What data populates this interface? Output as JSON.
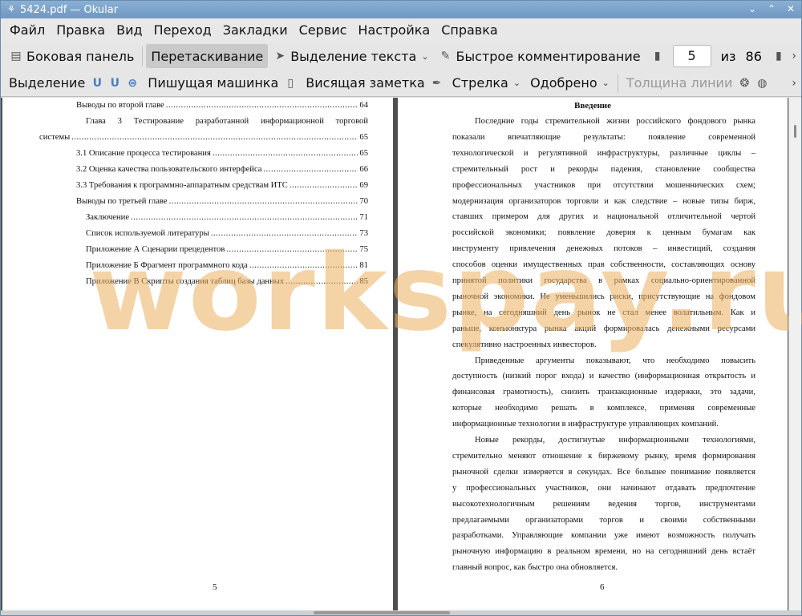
{
  "window": {
    "title": "5424.pdf  — Okular",
    "minimize_glyph": "⌄",
    "maximize_glyph": "⌃",
    "close_glyph": "✕"
  },
  "menu": [
    "Файл",
    "Правка",
    "Вид",
    "Переход",
    "Закладки",
    "Сервис",
    "Настройка",
    "Справка"
  ],
  "toolbar1": {
    "sidebar": "Боковая панель",
    "browse": "Перетаскивание",
    "text_select": "Выделение текста",
    "quick_annotations": "Быстрое комментирование",
    "page_current": "5",
    "page_of": "из",
    "page_total": "86"
  },
  "toolbar2": {
    "highlight": "Выделение",
    "typewriter": "Пишущая машинка",
    "note": "Висящая заметка",
    "arrow": "Стрелка",
    "stamp": "Одобрено",
    "line_width": "Толщина линии"
  },
  "page_left": {
    "toc": [
      {
        "text": "Выводы по второй главе",
        "page": "64"
      },
      {
        "text_line1": "Глава 3 Тестирование разработанной информационной торговой",
        "text_line2": "системы",
        "page": "65"
      },
      {
        "text": "3.1 Описание процесса тестирования",
        "page": "65"
      },
      {
        "text": "3.2 Оценка качества пользовательского интерфейса",
        "page": "66"
      },
      {
        "text": "3.3 Требования к программно-аппаратным средствам ИТС",
        "page": "69"
      },
      {
        "text": "Выводы по третьей главе",
        "page": "70"
      },
      {
        "text": "Заключение",
        "page": "71"
      },
      {
        "text": "Список используемой литературы",
        "page": "73"
      },
      {
        "text": "Приложение А Сценарии прецедентов",
        "page": "75"
      },
      {
        "text": "Приложение Б Фрагмент программного кода",
        "page": "81"
      },
      {
        "text": "Приложение В Скрипты создания таблиц базы данных",
        "page": "85"
      }
    ],
    "page_number": "5"
  },
  "page_right": {
    "heading": "Введение",
    "lines": [
      "Последние годы стремительной жизни российского фондового рынка",
      "показали впечатляющие результаты: появление современной",
      "технологической и регулятивной инфраструктуры, различные циклы –",
      "стремительный рост и рекорды падения, становление сообщества",
      "профессиональных участников при отсутствии мошеннических схем;",
      "модернизация организаторов торговли и как следствие – новые типы бирж,",
      "ставших примером для других и национальной отличительной чертой",
      "российской экономики; появление доверия к ценным бумагам как",
      "инструменту привлечения денежных потоков – инвестиций, создания",
      "способов оценки имущественных прав собственности, составляющих основу",
      "принятой политики государства в рамках социально-ориентированной",
      "рыночной экономики. Не уменьшились риски, присутствующие на фондовом",
      "рынке, на сегодняшний день рынок не стал менее волатильным. Как и",
      "раньше, конъюнктура рынка акций формировалась денежными ресурсами",
      "спекулятивно настроенных инвесторов.",
      "Приведенные аргументы показывают, что необходимо повысить",
      "доступность (низкий порог входа) и качество (информационная открытость и",
      "финансовая грамотность), снизить транзакционные издержки, это задачи,",
      "которые необходимо решать в комплексе, применяя современные",
      "информационные технологии в инфраструктуре управляющих компаний.",
      "Новые рекорды, достигнутые информационными технологиями,",
      "стремительно меняют отношение к биржевому рынку, время формирования",
      "рыночной сделки измеряется в секундах. Все большее понимание появляется",
      "у профессиональных участников, они начинают отдавать предпочтение",
      "высокотехнологичным решениям ведения торгов, инструментами",
      "предлагаемыми организаторами торгов и своими собственными",
      "разработками. Управляющие компании уже имеют возможность получать",
      "рыночную информацию в реальном времени, но на сегодняшний день встаёт",
      "главный вопрос, как быстро она обновляется."
    ],
    "page_number": "6"
  },
  "watermark": "workspay.ru"
}
